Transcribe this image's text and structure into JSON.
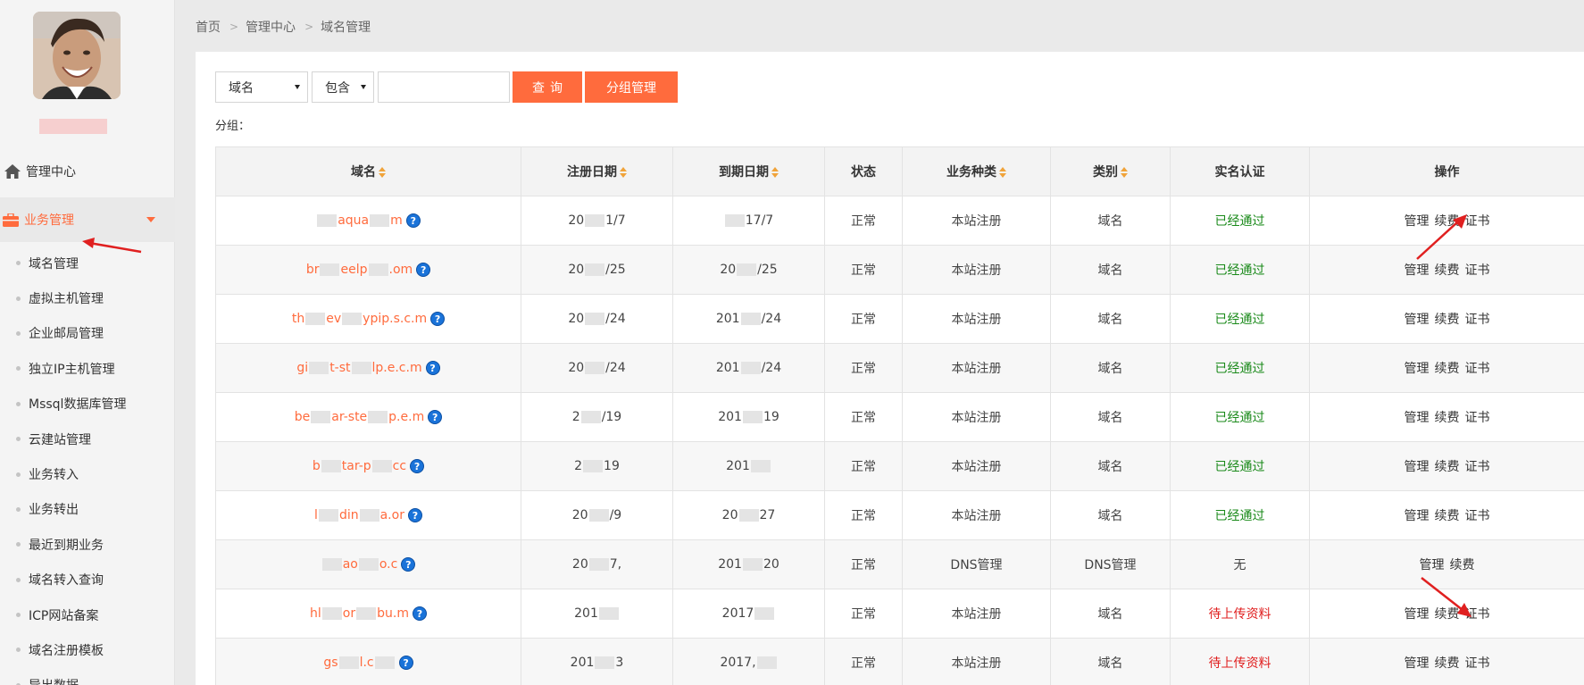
{
  "breadcrumb": [
    "首页",
    "管理中心",
    "域名管理"
  ],
  "sidebar": {
    "top_item": "管理中心",
    "group_label": "业务管理",
    "items": [
      "域名管理",
      "虚拟主机管理",
      "企业邮局管理",
      "独立IP主机管理",
      "Mssql数据库管理",
      "云建站管理",
      "业务转入",
      "业务转出",
      "最近到期业务",
      "域名转入查询",
      "ICP网站备案",
      "域名注册模板",
      "导出数据"
    ]
  },
  "toolbar": {
    "field_select": "域名",
    "operator_select": "包含",
    "search_value": "",
    "query_button": "查询",
    "group_button": "分组管理",
    "group_label": "分组："
  },
  "table": {
    "headers": [
      "域名",
      "注册日期",
      "到期日期",
      "状态",
      "业务种类",
      "类别",
      "实名认证",
      "操作"
    ],
    "rows": [
      {
        "domain_a": "",
        "domain_b": "aqua",
        "domain_c": "m",
        "reg_a": "20",
        "reg_b": "1/7",
        "exp_a": "",
        "exp_b": "17",
        "exp_c": "/7",
        "status": "正常",
        "kind": "本站注册",
        "category": "域名",
        "verify": "已经通过",
        "verify_type": "ok",
        "ops": [
          "管理",
          "续费",
          "证书"
        ]
      },
      {
        "domain_a": "br",
        "domain_b": "eelp",
        "domain_c": ".om",
        "reg_a": "20",
        "reg_b": "/25",
        "exp_a": "20",
        "exp_b": "",
        "exp_c": "/25",
        "status": "正常",
        "kind": "本站注册",
        "category": "域名",
        "verify": "已经通过",
        "verify_type": "ok",
        "ops": [
          "管理",
          "续费",
          "证书"
        ]
      },
      {
        "domain_a": "th",
        "domain_b": "ev",
        "domain_c": "ypip.s.c.m",
        "reg_a": "20",
        "reg_b": "/24",
        "exp_a": "201",
        "exp_b": "",
        "exp_c": "/24",
        "status": "正常",
        "kind": "本站注册",
        "category": "域名",
        "verify": "已经通过",
        "verify_type": "ok",
        "ops": [
          "管理",
          "续费",
          "证书"
        ]
      },
      {
        "domain_a": "gi",
        "domain_b": "t-st",
        "domain_c": "lp.e.c.m",
        "reg_a": "20",
        "reg_b": "/24",
        "exp_a": "201",
        "exp_b": "",
        "exp_c": "/24",
        "status": "正常",
        "kind": "本站注册",
        "category": "域名",
        "verify": "已经通过",
        "verify_type": "ok",
        "ops": [
          "管理",
          "续费",
          "证书"
        ]
      },
      {
        "domain_a": "be",
        "domain_b": "ar-ste",
        "domain_c": "p.e.m",
        "reg_a": "2",
        "reg_b": "/19",
        "exp_a": "201",
        "exp_b": "",
        "exp_c": "19",
        "status": "正常",
        "kind": "本站注册",
        "category": "域名",
        "verify": "已经通过",
        "verify_type": "ok",
        "ops": [
          "管理",
          "续费",
          "证书"
        ]
      },
      {
        "domain_a": "b",
        "domain_b": "tar-p",
        "domain_c": "cc",
        "reg_a": "2",
        "reg_b": "19",
        "exp_a": "201",
        "exp_b": "",
        "exp_c": "",
        "status": "正常",
        "kind": "本站注册",
        "category": "域名",
        "verify": "已经通过",
        "verify_type": "ok",
        "ops": [
          "管理",
          "续费",
          "证书"
        ]
      },
      {
        "domain_a": "l",
        "domain_b": "din",
        "domain_c": "a.or",
        "reg_a": "20",
        "reg_b": "/9",
        "exp_a": "20",
        "exp_b": "",
        "exp_c": "27",
        "status": "正常",
        "kind": "本站注册",
        "category": "域名",
        "verify": "已经通过",
        "verify_type": "ok",
        "ops": [
          "管理",
          "续费",
          "证书"
        ]
      },
      {
        "domain_a": "",
        "domain_b": "ao",
        "domain_c": "o.c",
        "reg_a": "20",
        "reg_b": "7,",
        "exp_a": "201",
        "exp_b": "",
        "exp_c": "20",
        "status": "正常",
        "kind": "DNS管理",
        "category": "DNS管理",
        "verify": "无",
        "verify_type": "none",
        "ops": [
          "管理",
          "续费"
        ]
      },
      {
        "domain_a": "hl",
        "domain_b": "or",
        "domain_c": "bu.m",
        "reg_a": "201",
        "reg_b": "",
        "exp_a": "2017",
        "exp_b": "",
        "exp_c": "",
        "status": "正常",
        "kind": "本站注册",
        "category": "域名",
        "verify": "待上传资料",
        "verify_type": "pending",
        "ops": [
          "管理",
          "续费",
          "证书"
        ]
      },
      {
        "domain_a": "gs",
        "domain_b": "l.c",
        "domain_c": "",
        "reg_a": "201",
        "reg_b": "3",
        "exp_a": "2017,",
        "exp_b": "",
        "exp_c": "",
        "status": "正常",
        "kind": "本站注册",
        "category": "域名",
        "verify": "待上传资料",
        "verify_type": "pending",
        "ops": [
          "管理",
          "续费",
          "证书"
        ]
      }
    ]
  },
  "colors": {
    "accent": "#ff6b3d",
    "ok": "#1a8a1a",
    "pending": "#e02020",
    "help_icon": "#1a73d9"
  }
}
